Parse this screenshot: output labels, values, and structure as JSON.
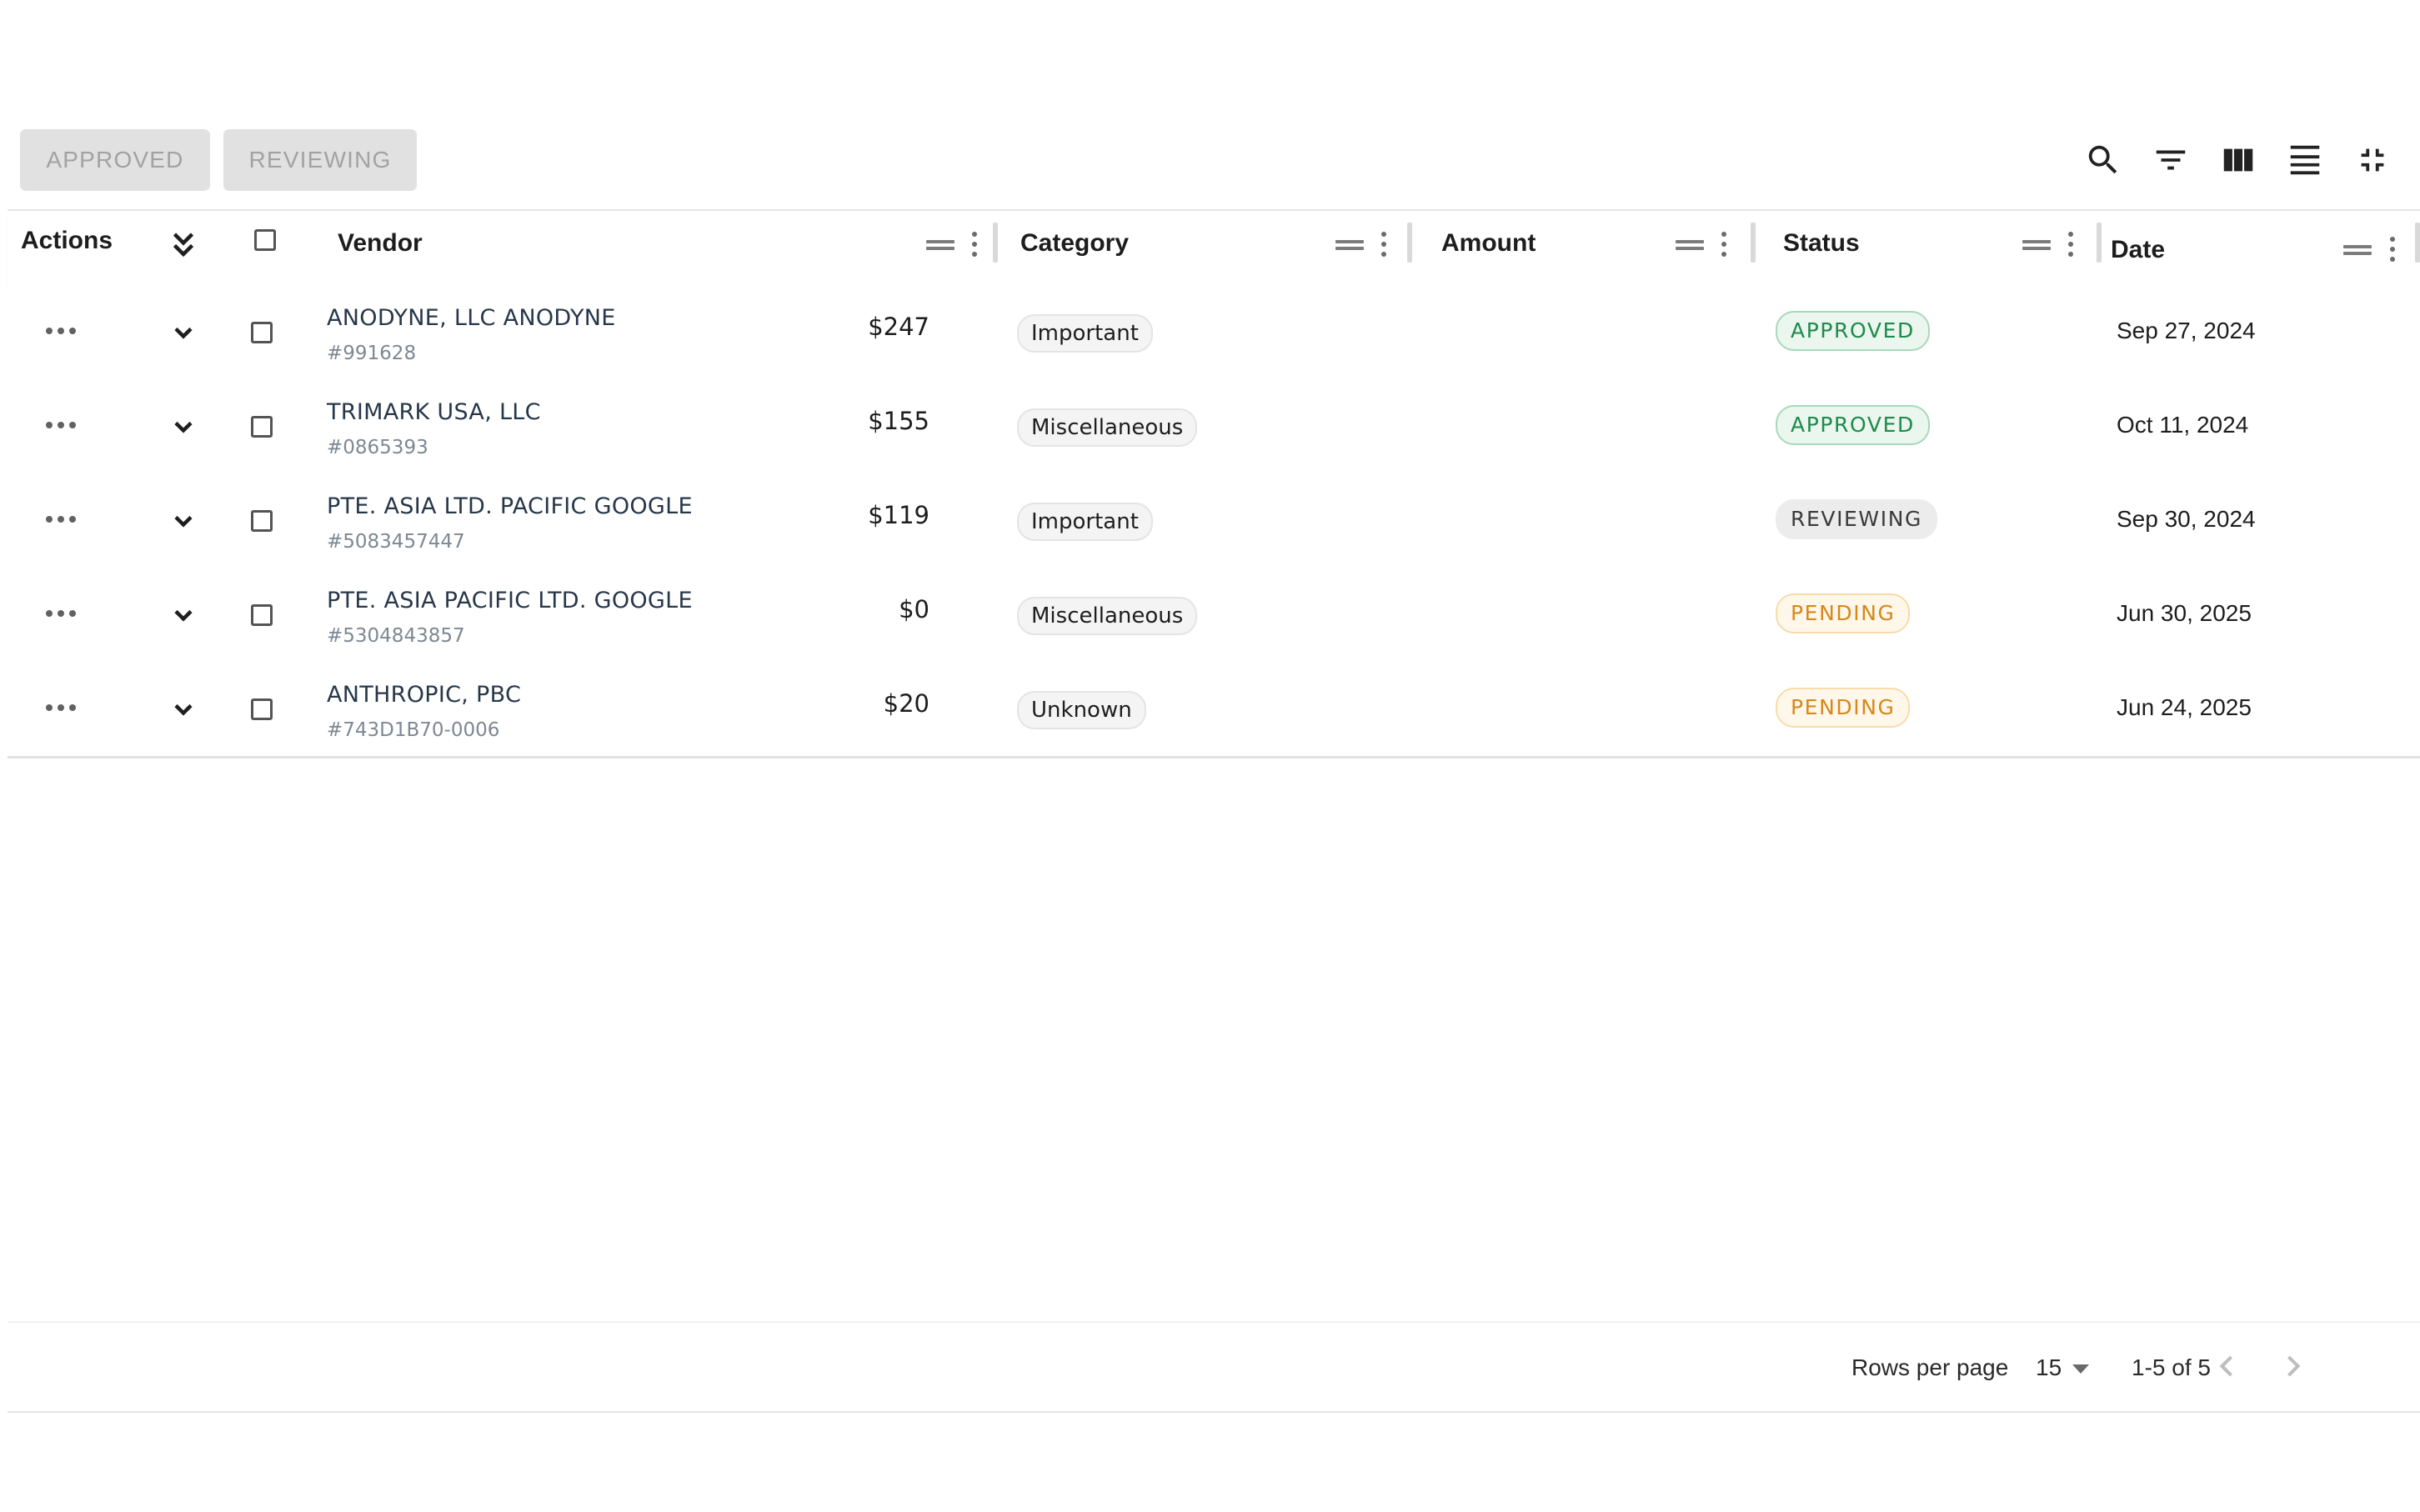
{
  "toolbar": {
    "buttons": [
      {
        "label": "APPROVED"
      },
      {
        "label": "REVIEWING"
      }
    ],
    "icons": [
      "search-icon",
      "filter-icon",
      "columns-icon",
      "density-icon",
      "fullscreen-exit-icon"
    ]
  },
  "table": {
    "headers": {
      "actions": "Actions",
      "vendor": "Vendor",
      "category": "Category",
      "amount": "Amount",
      "status": "Status",
      "date": "Date"
    },
    "rows": [
      {
        "vendor": "ANODYNE, LLC ANODYNE",
        "id": "#991628",
        "category": "Important",
        "amount": "$247",
        "status": "APPROVED",
        "date": "Sep 27, 2024"
      },
      {
        "vendor": "TRIMARK USA, LLC",
        "id": "#0865393",
        "category": "Miscellaneous",
        "amount": "$155",
        "status": "APPROVED",
        "date": "Oct 11, 2024"
      },
      {
        "vendor": "PTE. ASIA LTD. PACIFIC GOOGLE",
        "id": "#5083457447",
        "category": "Important",
        "amount": "$119",
        "status": "REVIEWING",
        "date": "Sep 30, 2024"
      },
      {
        "vendor": "PTE. ASIA PACIFIC LTD. GOOGLE",
        "id": "#5304843857",
        "category": "Miscellaneous",
        "amount": "$0",
        "status": "PENDING",
        "date": "Jun 30, 2025"
      },
      {
        "vendor": "ANTHROPIC, PBC",
        "id": "#743D1B70-0006",
        "category": "Unknown",
        "amount": "$20",
        "status": "PENDING",
        "date": "Jun 24, 2025"
      }
    ]
  },
  "status_colors": {
    "APPROVED": {
      "text": "#1e8a4c",
      "bg": "#eaf6ee",
      "border": "#a9d9bb"
    },
    "REVIEWING": {
      "text": "#3a3a3a",
      "bg": "#ececec",
      "border": "#ececec"
    },
    "PENDING": {
      "text": "#d9861a",
      "bg": "#fff8ea",
      "border": "#f7dba8"
    }
  },
  "pagination": {
    "rows_per_page_label": "Rows per page",
    "rows_per_page": "15",
    "range": "1-5 of 5"
  }
}
